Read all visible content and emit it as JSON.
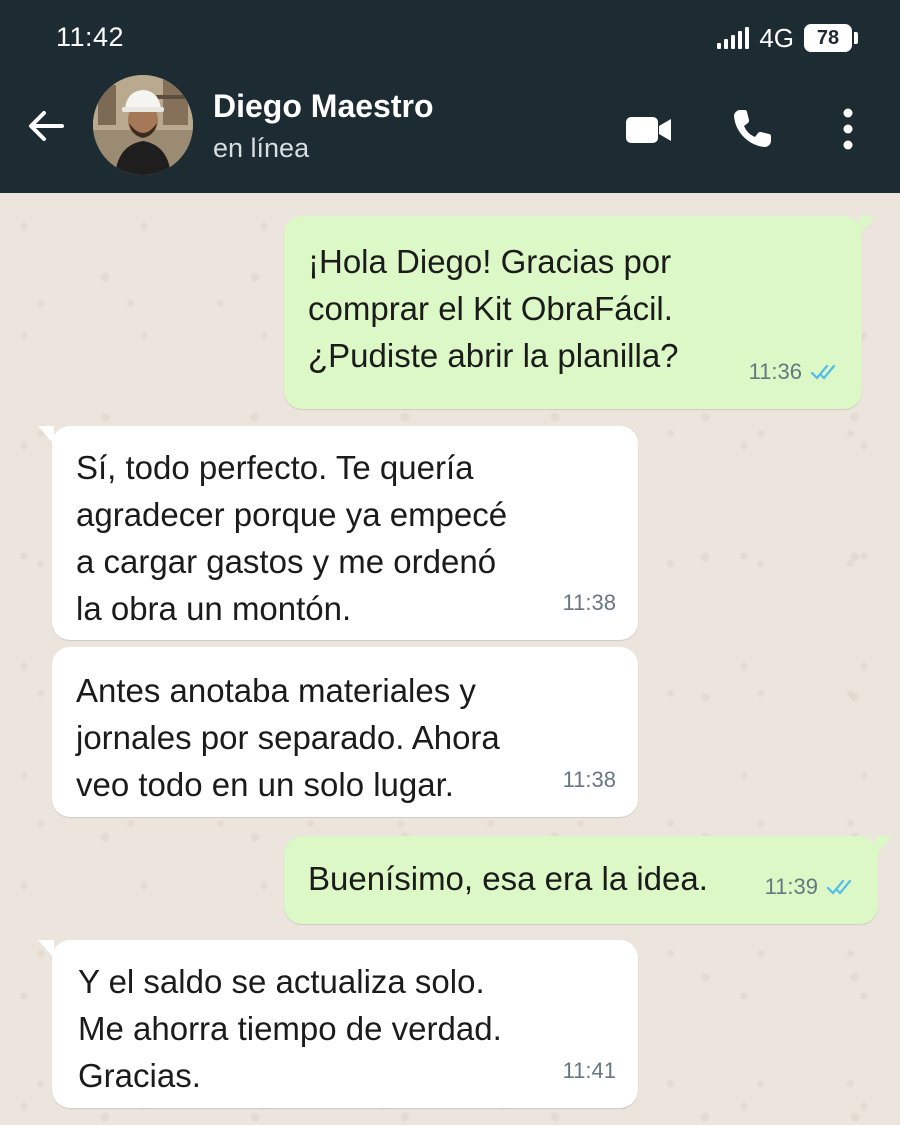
{
  "status_bar": {
    "time": "11:42",
    "network": "4G",
    "battery": "78"
  },
  "header": {
    "contact_name": "Diego Maestro",
    "contact_status": "en línea",
    "icons": [
      "back-arrow-icon",
      "video-call-icon",
      "phone-icon",
      "more-options-icon"
    ]
  },
  "colors": {
    "header_bg": "#1d2b33",
    "outgoing_bubble": "#dcf8c6",
    "incoming_bubble": "#ffffff",
    "chat_bg": "#ece5dd",
    "read_ticks": "#53bdeb"
  },
  "messages": [
    {
      "direction": "out",
      "text": "¡Hola Diego! Gracias por\ncomprar el Kit ObraFácil.\n¿Pudiste abrir la planilla?",
      "time": "11:36",
      "status": "read"
    },
    {
      "direction": "in",
      "text": "Sí, todo perfecto. Te quería\nagradecer porque ya empecé\na cargar gastos y me ordenó\nla obra un montón.",
      "time": "11:38"
    },
    {
      "direction": "in",
      "text": "Antes anotaba materiales y\njornales por separado. Ahora\nveo todo en un solo lugar.",
      "time": "11:38"
    },
    {
      "direction": "out",
      "text": "Buenísimo, esa era la idea.",
      "time": "11:39",
      "status": "read"
    },
    {
      "direction": "in",
      "text": "Y el saldo se actualiza solo.\nMe ahorra tiempo de verdad.\nGracias.",
      "time": "11:41"
    }
  ]
}
